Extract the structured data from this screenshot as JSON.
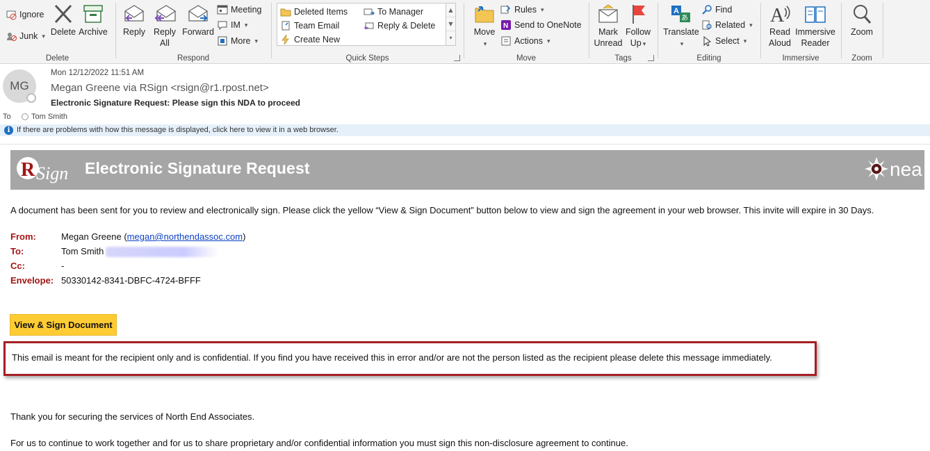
{
  "ribbon": {
    "delete_group": {
      "label": "Delete",
      "ignore": "Ignore",
      "junk": "Junk",
      "delete": "Delete",
      "archive": "Archive"
    },
    "respond_group": {
      "label": "Respond",
      "reply": "Reply",
      "reply_all_1": "Reply",
      "reply_all_2": "All",
      "forward": "Forward",
      "meeting": "Meeting",
      "im": "IM",
      "more": "More"
    },
    "quick_steps_group": {
      "label": "Quick Steps",
      "items": [
        "Deleted Items",
        "To Manager",
        "Team Email",
        "Reply & Delete",
        "Create New"
      ]
    },
    "move_group": {
      "label": "Move",
      "move": "Move",
      "rules": "Rules",
      "onenote": "Send to OneNote",
      "actions": "Actions"
    },
    "tags_group": {
      "label": "Tags",
      "mark_unread_1": "Mark",
      "mark_unread_2": "Unread",
      "follow_up_1": "Follow",
      "follow_up_2": "Up"
    },
    "editing_group": {
      "label": "Editing",
      "translate": "Translate",
      "find": "Find",
      "related": "Related",
      "select": "Select"
    },
    "immersive_group": {
      "label": "Immersive",
      "read_aloud_1": "Read",
      "read_aloud_2": "Aloud",
      "immersive_reader_1": "Immersive",
      "immersive_reader_2": "Reader"
    },
    "zoom_group": {
      "label": "Zoom",
      "zoom": "Zoom"
    }
  },
  "message": {
    "avatar_initials": "MG",
    "date": "Mon 12/12/2022 11:51 AM",
    "sender": "Megan Greene via RSign <rsign@r1.rpost.net>",
    "subject": "Electronic Signature Request: Please sign this NDA to proceed",
    "to_label": "To",
    "to_name": "Tom Smith",
    "infobar": "If there are problems with how this message is displayed, click here to view it in a web browser."
  },
  "body": {
    "banner_title": "Electronic Signature Request",
    "logo_text": "nea",
    "intro": "A document has been sent for you to review and electronically sign. Please click the yellow “View & Sign Document” button below to view and sign the agreement in your web browser. This invite will expire in 30 Days.",
    "from_label": "From:",
    "from_name": "Megan Greene (",
    "from_email": "megan@northendassoc.com",
    "from_close": ")",
    "to_label": "To:",
    "to_value": "Tom Smith",
    "cc_label": "Cc:",
    "cc_value": "-",
    "envelope_label": "Envelope:",
    "envelope_value": "50330142-8341-DBFC-4724-BFFF",
    "sign_button": "View & Sign Document",
    "confidential": "This email is meant for the recipient only and is confidential. If you find you have received this in error and/or are not the person listed as the recipient please delete this message immediately.",
    "thanks": "Thank you for securing the services of North End Associates.",
    "continue": "For us to continue to work together and for us to share proprietary and/or confidential information you must sign this non-disclosure agreement to continue."
  },
  "colors": {
    "accent_red": "#a31515",
    "button_yellow": "#ffcc33",
    "banner_gray": "#a6a6a6",
    "link_blue": "#0b3fc4"
  }
}
